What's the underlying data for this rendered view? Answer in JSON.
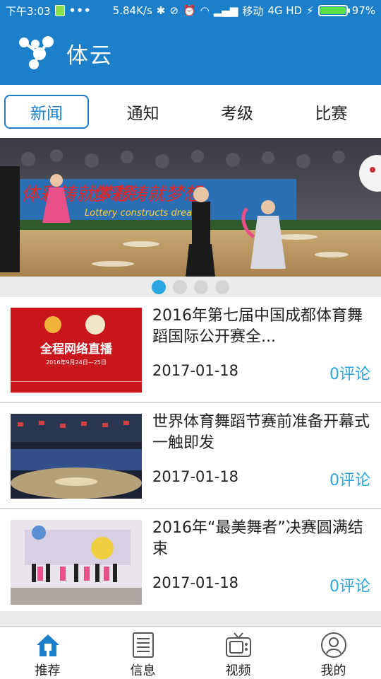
{
  "status_bar": {
    "time": "下午3:03",
    "speed": "5.84K/s",
    "carrier": "移动",
    "network": "4G HD",
    "battery": "97%"
  },
  "app_bar": {
    "title": "体云"
  },
  "tabs": [
    {
      "label": "新闻",
      "active": true
    },
    {
      "label": "通知",
      "active": false
    },
    {
      "label": "考级",
      "active": false
    },
    {
      "label": "比赛",
      "active": false
    }
  ],
  "banner": {
    "slides": 4,
    "active_slide": 1,
    "slogan_visible": "体彩铸就梦想",
    "slogan_en": "Lottery constructs dream"
  },
  "news": [
    {
      "title": "2016年第七届中国成都体育舞蹈国际公开赛全...",
      "date": "2017-01-18",
      "comments": "0评论",
      "thumb_text1": "全程网络直播",
      "thumb_text2": "2016年9月24日—25日"
    },
    {
      "title": "世界体育舞蹈节赛前准备开幕式一触即发",
      "date": "2017-01-18",
      "comments": "0评论"
    },
    {
      "title": "2016年“最美舞者”决赛圆满结束",
      "date": "2017-01-18",
      "comments": "0评论"
    }
  ],
  "bottom_nav": [
    {
      "label": "推荐",
      "icon": "home-icon",
      "active": true
    },
    {
      "label": "信息",
      "icon": "document-icon",
      "active": false
    },
    {
      "label": "视频",
      "icon": "tv-icon",
      "active": false
    },
    {
      "label": "我的",
      "icon": "profile-icon",
      "active": false
    }
  ],
  "colors": {
    "primary": "#1b7fc9",
    "accent": "#2ba6e0"
  }
}
